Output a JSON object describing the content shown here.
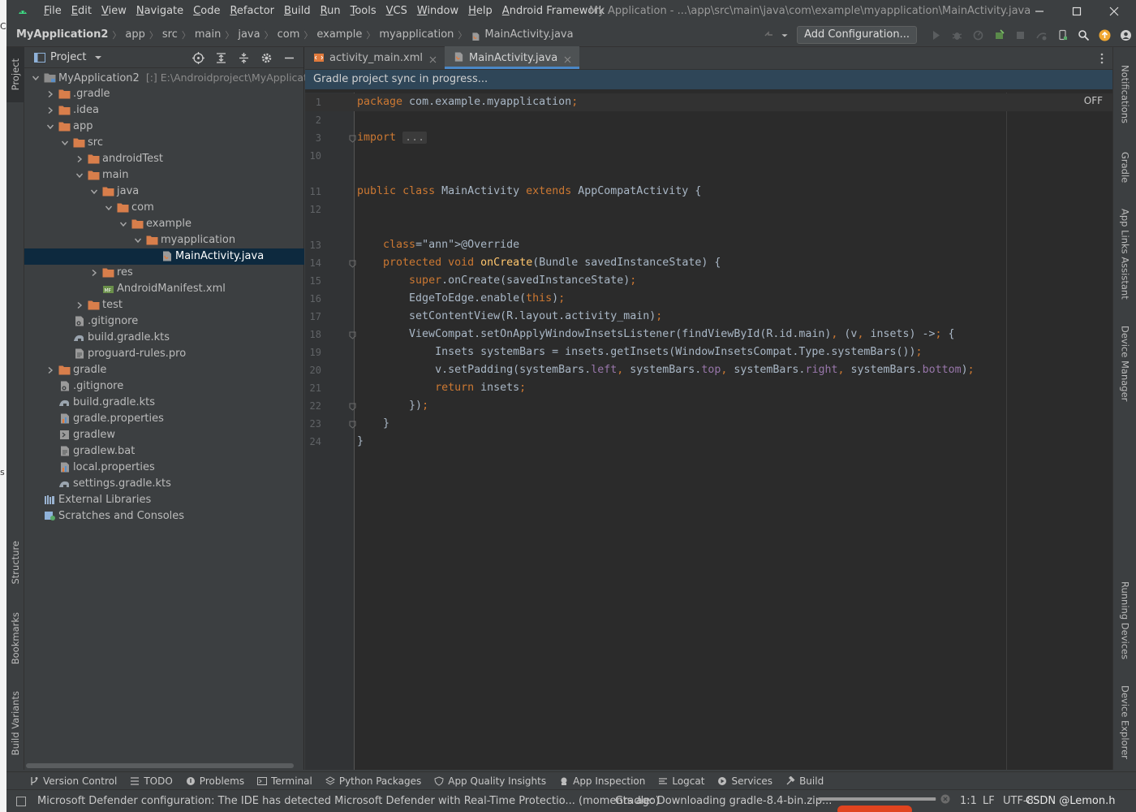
{
  "app": {
    "menu": [
      "File",
      "Edit",
      "View",
      "Navigate",
      "Code",
      "Refactor",
      "Build",
      "Run",
      "Tools",
      "VCS",
      "Window",
      "Help",
      "Android Framework"
    ],
    "window_title": "My Application - ...\\app\\src\\main\\java\\com\\example\\myapplication\\MainActivity.java"
  },
  "navbar": {
    "breadcrumbs": [
      "MyApplication2",
      "app",
      "src",
      "main",
      "java",
      "com",
      "example",
      "myapplication",
      "MainActivity.java"
    ],
    "add_configuration": "Add Configuration..."
  },
  "left_strip": {
    "project": "Project",
    "structure": "Structure",
    "bookmarks": "Bookmarks",
    "build_variants": "Build Variants"
  },
  "project_panel": {
    "title": "Project",
    "tree": [
      {
        "label": "MyApplication2",
        "extra": "[:]  E:\\Androidproject\\MyApplication",
        "depth": 0,
        "expanded": true,
        "icon": "module-folder-icon"
      },
      {
        "label": ".gradle",
        "depth": 1,
        "expanded": false,
        "icon": "folder-icon"
      },
      {
        "label": ".idea",
        "depth": 1,
        "expanded": false,
        "icon": "folder-icon"
      },
      {
        "label": "app",
        "depth": 1,
        "expanded": true,
        "icon": "folder-icon"
      },
      {
        "label": "src",
        "depth": 2,
        "expanded": true,
        "icon": "folder-icon"
      },
      {
        "label": "androidTest",
        "depth": 3,
        "expanded": false,
        "icon": "folder-icon"
      },
      {
        "label": "main",
        "depth": 3,
        "expanded": true,
        "icon": "folder-icon"
      },
      {
        "label": "java",
        "depth": 4,
        "expanded": true,
        "icon": "folder-icon"
      },
      {
        "label": "com",
        "depth": 5,
        "expanded": true,
        "icon": "folder-icon"
      },
      {
        "label": "example",
        "depth": 6,
        "expanded": true,
        "icon": "folder-icon"
      },
      {
        "label": "myapplication",
        "depth": 7,
        "expanded": true,
        "icon": "folder-icon"
      },
      {
        "label": "MainActivity.java",
        "depth": 8,
        "icon": "java-file-icon",
        "selected": true
      },
      {
        "label": "res",
        "depth": 4,
        "expanded": false,
        "icon": "folder-icon"
      },
      {
        "label": "AndroidManifest.xml",
        "depth": 4,
        "icon": "manifest-file-icon"
      },
      {
        "label": "test",
        "depth": 3,
        "expanded": false,
        "icon": "folder-icon"
      },
      {
        "label": ".gitignore",
        "depth": 2,
        "icon": "gitignore-file-icon"
      },
      {
        "label": "build.gradle.kts",
        "depth": 2,
        "icon": "gradle-file-icon"
      },
      {
        "label": "proguard-rules.pro",
        "depth": 2,
        "icon": "text-file-icon"
      },
      {
        "label": "gradle",
        "depth": 1,
        "expanded": false,
        "icon": "folder-icon"
      },
      {
        "label": ".gitignore",
        "depth": 1,
        "icon": "gitignore-file-icon"
      },
      {
        "label": "build.gradle.kts",
        "depth": 1,
        "icon": "gradle-file-icon"
      },
      {
        "label": "gradle.properties",
        "depth": 1,
        "icon": "properties-file-icon"
      },
      {
        "label": "gradlew",
        "depth": 1,
        "icon": "script-file-icon"
      },
      {
        "label": "gradlew.bat",
        "depth": 1,
        "icon": "text-file-icon"
      },
      {
        "label": "local.properties",
        "depth": 1,
        "icon": "properties-file-icon"
      },
      {
        "label": "settings.gradle.kts",
        "depth": 1,
        "icon": "gradle-file-icon"
      },
      {
        "label": "External Libraries",
        "depth": 0,
        "icon": "libraries-icon"
      },
      {
        "label": "Scratches and Consoles",
        "depth": 0,
        "icon": "scratches-icon"
      }
    ]
  },
  "editor": {
    "tabs": [
      {
        "label": "activity_main.xml",
        "active": false
      },
      {
        "label": "MainActivity.java",
        "active": true
      }
    ],
    "banner": "Gradle project sync in progress...",
    "inlay_toggle": "OFF",
    "lines": [
      {
        "n": "1",
        "code": "package com.example.myapplication;"
      },
      {
        "n": "2",
        "code": ""
      },
      {
        "n": "3",
        "code": "import ..."
      },
      {
        "n": "10",
        "code": ""
      },
      {
        "n": "",
        "code": ""
      },
      {
        "n": "11",
        "code": "public class MainActivity extends AppCompatActivity {"
      },
      {
        "n": "12",
        "code": ""
      },
      {
        "n": "",
        "code": ""
      },
      {
        "n": "13",
        "code": "    @Override"
      },
      {
        "n": "14",
        "code": "    protected void onCreate(Bundle savedInstanceState) {"
      },
      {
        "n": "15",
        "code": "        super.onCreate(savedInstanceState);"
      },
      {
        "n": "16",
        "code": "        EdgeToEdge.enable(this);"
      },
      {
        "n": "17",
        "code": "        setContentView(R.layout.activity_main);"
      },
      {
        "n": "18",
        "code": "        ViewCompat.setOnApplyWindowInsetsListener(findViewById(R.id.main), (v, insets) -> {"
      },
      {
        "n": "19",
        "code": "            Insets systemBars = insets.getInsets(WindowInsetsCompat.Type.systemBars());"
      },
      {
        "n": "20",
        "code": "            v.setPadding(systemBars.left, systemBars.top, systemBars.right, systemBars.bottom);"
      },
      {
        "n": "21",
        "code": "            return insets;"
      },
      {
        "n": "22",
        "code": "        });"
      },
      {
        "n": "23",
        "code": "    }"
      },
      {
        "n": "24",
        "code": "}"
      }
    ]
  },
  "right_strip": {
    "notifications": "Notifications",
    "gradle": "Gradle",
    "app_links": "App Links Assistant",
    "device_manager": "Device Manager",
    "running_devices": "Running Devices",
    "device_explorer": "Device Explorer"
  },
  "bottom_tools": [
    {
      "label": "Version Control",
      "icon": "branch-icon"
    },
    {
      "label": "TODO",
      "icon": "list-icon"
    },
    {
      "label": "Problems",
      "icon": "info-circle-icon"
    },
    {
      "label": "Terminal",
      "icon": "terminal-icon"
    },
    {
      "label": "Python Packages",
      "icon": "layers-icon"
    },
    {
      "label": "App Quality Insights",
      "icon": "shield-icon"
    },
    {
      "label": "App Inspection",
      "icon": "inspect-icon"
    },
    {
      "label": "Logcat",
      "icon": "logcat-icon"
    },
    {
      "label": "Services",
      "icon": "play-circle-icon"
    },
    {
      "label": "Build",
      "icon": "hammer-icon"
    }
  ],
  "status": {
    "message": "Microsoft Defender configuration: The IDE has detected Microsoft Defender with Real-Time Protectio... (moments ago)",
    "gradle_task": "Gradle: Downloading gradle-8.4-bin.zip...",
    "progress": 0.99,
    "position": "1:1",
    "line_sep": "LF",
    "encoding": "UTF-8",
    "watermark": "CSDN @Lemon.h"
  },
  "colors": {
    "accent": "#4a88c7",
    "folder": "#d87e4b",
    "selected_row": "#0d293e",
    "banner": "#2f4658"
  }
}
